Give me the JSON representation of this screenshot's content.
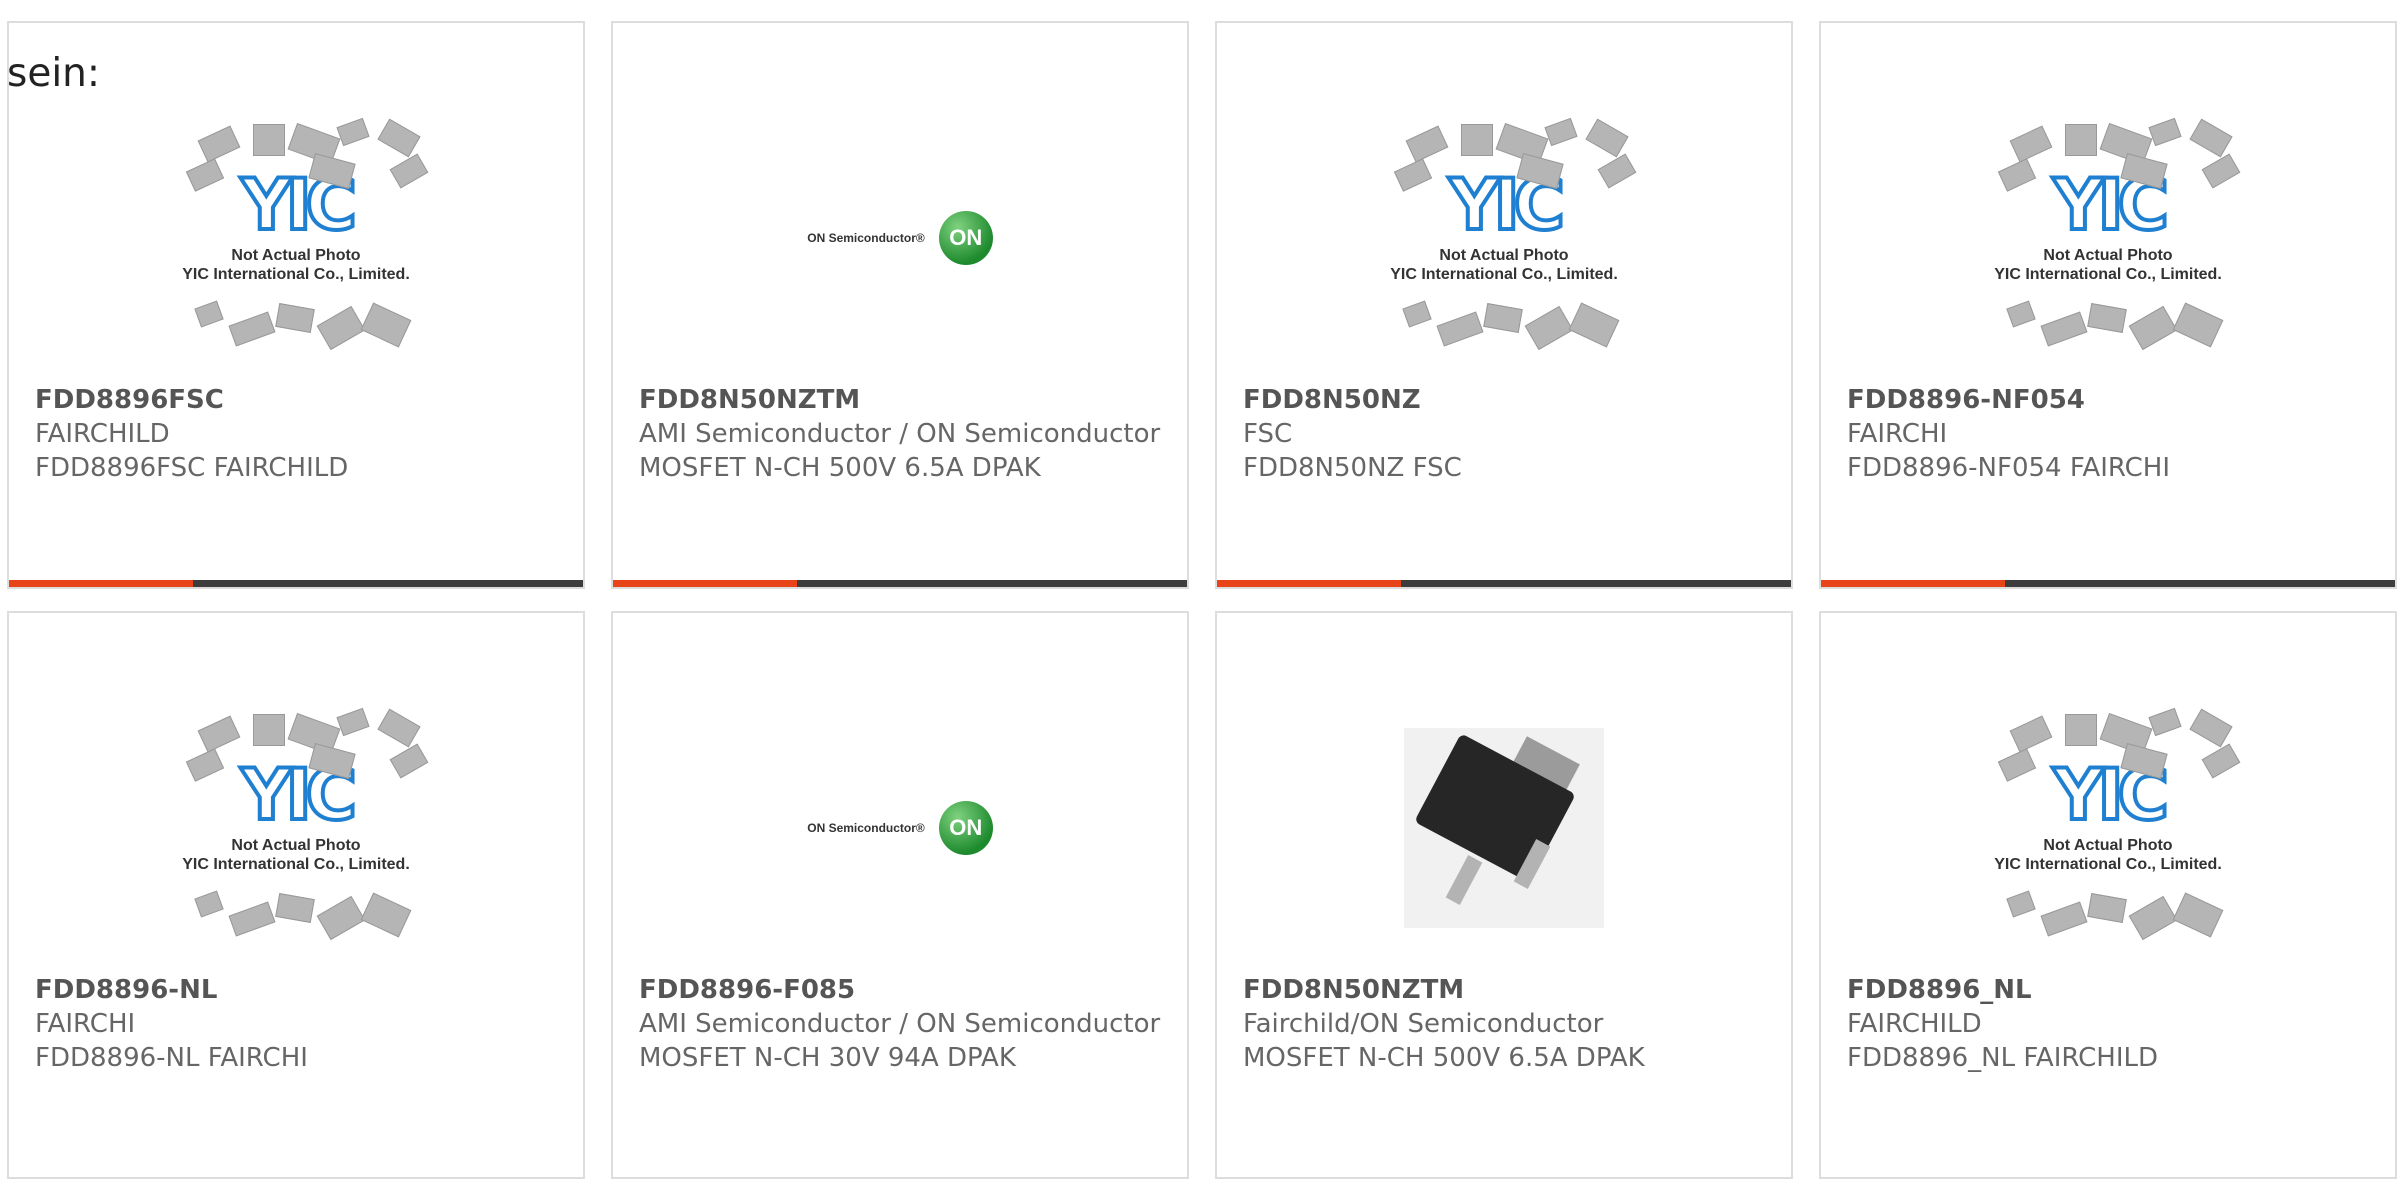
{
  "heading": "sein:",
  "colors": {
    "accent": "#e8441a",
    "bar": "#3d3d3d",
    "border": "#dddddd",
    "text": "#666666"
  },
  "placeholder": {
    "logo": "YIC",
    "line1": "Not Actual Photo",
    "line2": "YIC International Co., Limited."
  },
  "on_logo": {
    "text": "ON Semiconductor®",
    "mark": "ON"
  },
  "products": [
    {
      "image": "yic-placeholder",
      "pn": "FDD8896FSC",
      "mfr": "FAIRCHILD",
      "desc": "FDD8896FSC FAIRCHILD"
    },
    {
      "image": "on-semiconductor-logo",
      "pn": "FDD8N50NZTM",
      "mfr": "AMI Semiconductor / ON Semiconductor",
      "desc": "MOSFET N-CH 500V 6.5A DPAK"
    },
    {
      "image": "yic-placeholder",
      "pn": "FDD8N50NZ",
      "mfr": "FSC",
      "desc": "FDD8N50NZ FSC"
    },
    {
      "image": "yic-placeholder",
      "pn": "FDD8896-NF054",
      "mfr": "FAIRCHI",
      "desc": "FDD8896-NF054 FAIRCHI"
    },
    {
      "image": "yic-placeholder",
      "pn": "FDD8896-NL",
      "mfr": "FAIRCHI",
      "desc": "FDD8896-NL FAIRCHI"
    },
    {
      "image": "on-semiconductor-logo",
      "pn": "FDD8896-F085",
      "mfr": "AMI Semiconductor / ON Semiconductor",
      "desc": "MOSFET N-CH 30V 94A DPAK"
    },
    {
      "image": "dpak-photo",
      "pn": "FDD8N50NZTM",
      "mfr": "Fairchild/ON Semiconductor",
      "desc": "MOSFET N-CH 500V 6.5A DPAK"
    },
    {
      "image": "yic-placeholder",
      "pn": "FDD8896_NL",
      "mfr": "FAIRCHILD",
      "desc": "FDD8896_NL FAIRCHILD"
    }
  ]
}
